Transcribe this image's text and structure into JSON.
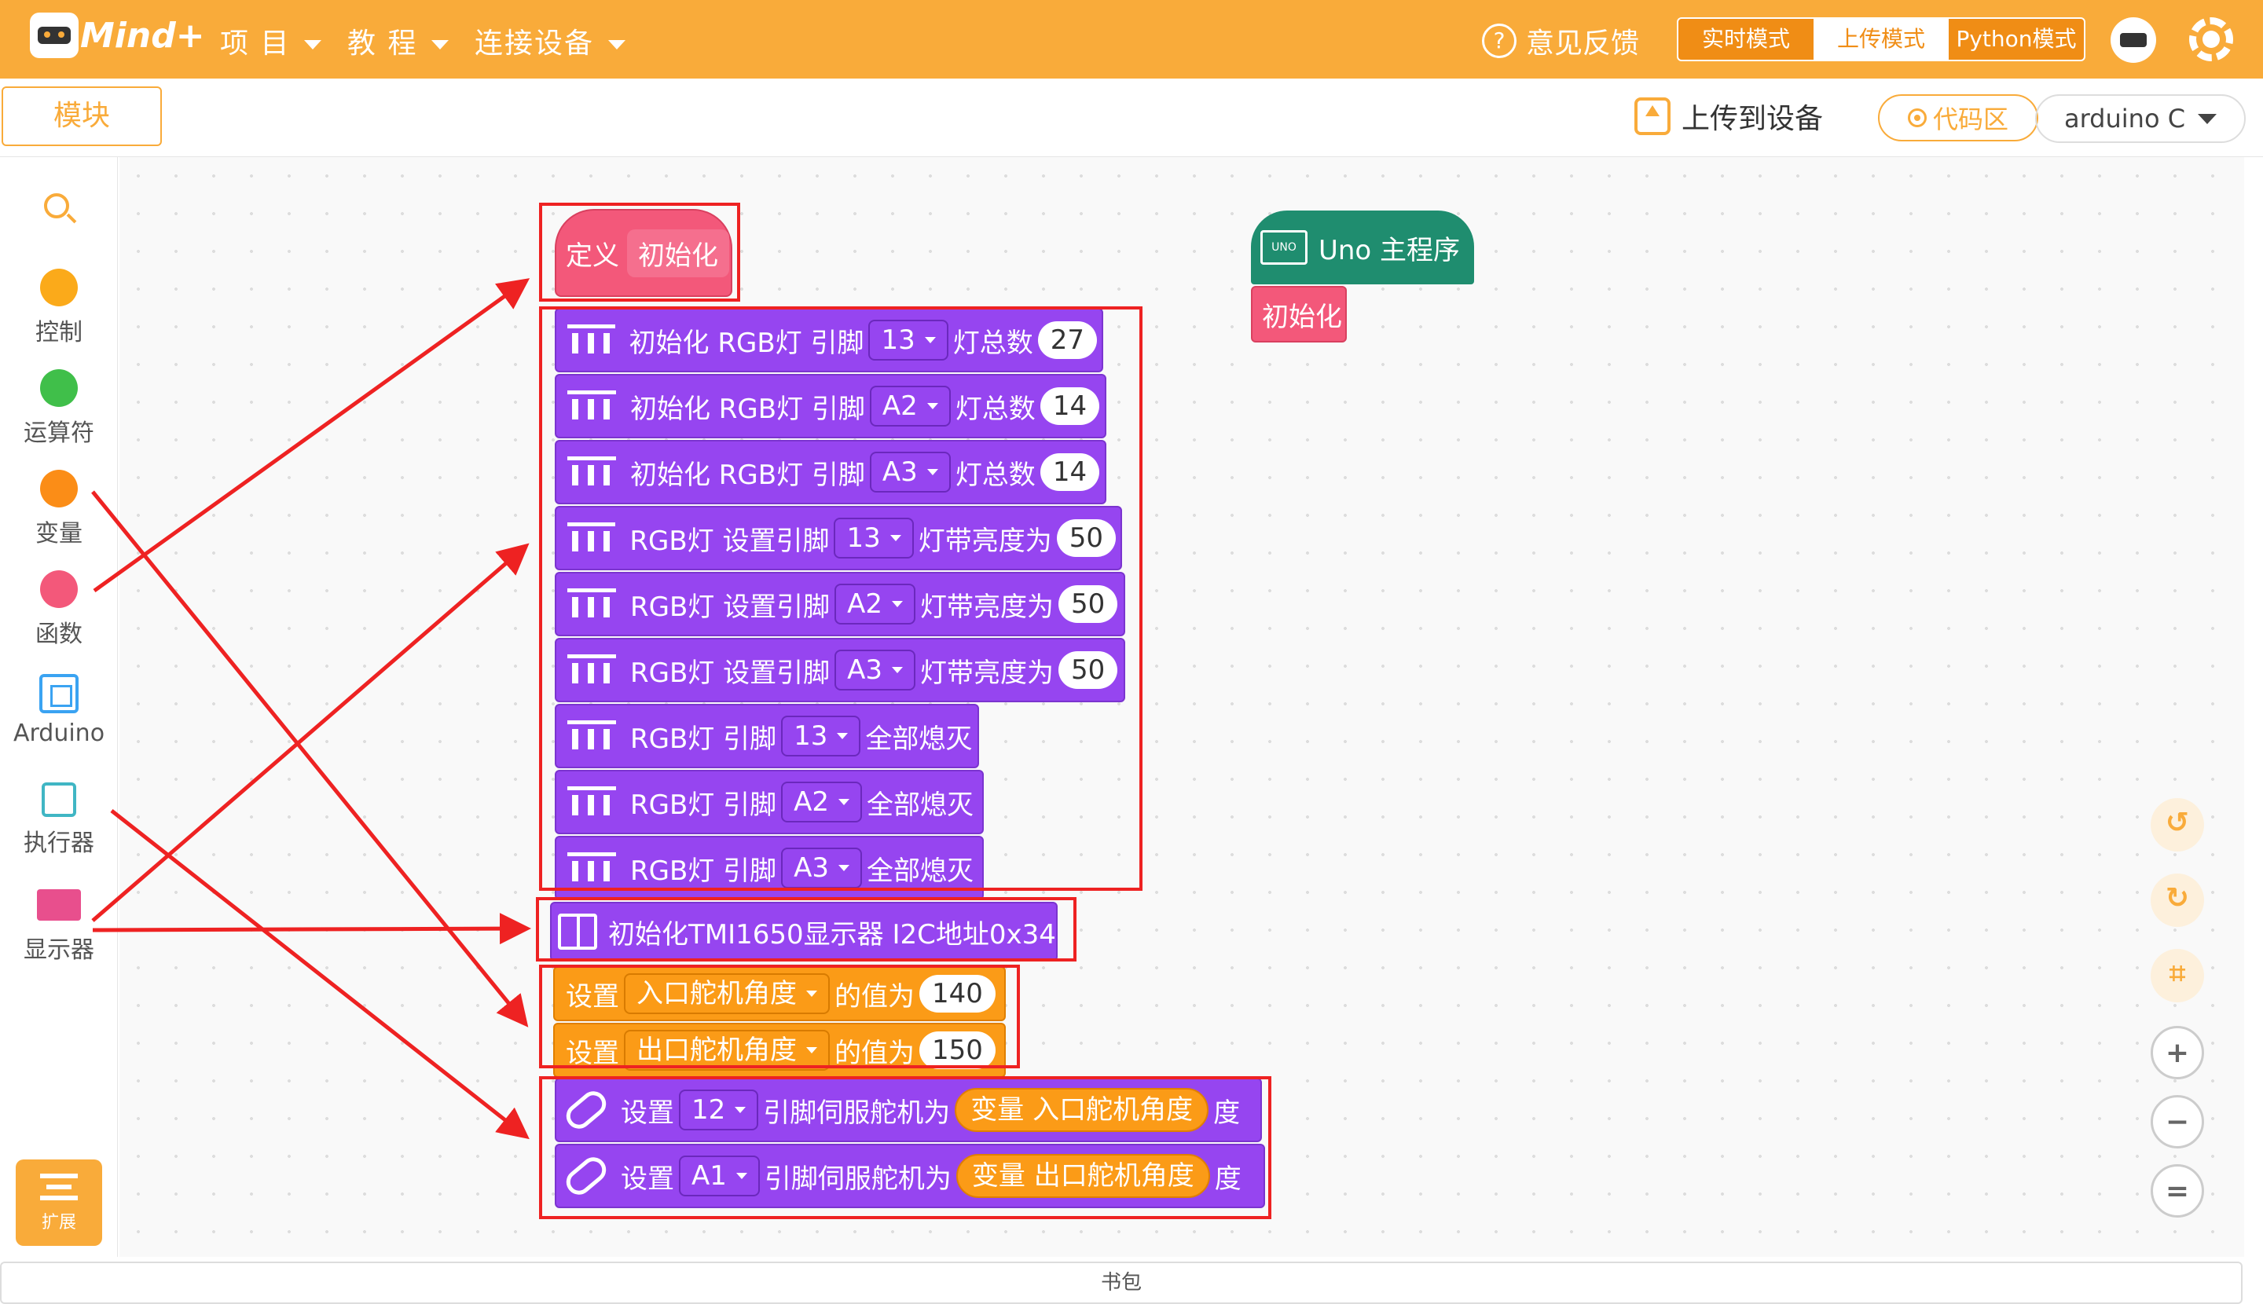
{
  "app": {
    "logo_text": "Mind+"
  },
  "menu": [
    {
      "label": "项 目"
    },
    {
      "label": "教 程"
    },
    {
      "label": "连接设备"
    }
  ],
  "feedback": {
    "label": "意见反馈",
    "icon": "question-icon"
  },
  "modes": [
    {
      "label": "实时模式"
    },
    {
      "label": "上传模式",
      "active": true
    },
    {
      "label": "Python模式"
    }
  ],
  "toolbar": {
    "modules_tab": "模块",
    "upload_label": "上传到设备",
    "code_label": "代码区",
    "language": "arduino C"
  },
  "sidebar": {
    "categories": [
      {
        "label": "控制",
        "color": "#fbaa1a"
      },
      {
        "label": "运算符",
        "color": "#40bf4a"
      },
      {
        "label": "变量",
        "color": "#fb8d17"
      },
      {
        "label": "函数",
        "color": "#f3587a"
      },
      {
        "label": "Arduino",
        "icon": "chip-icon"
      },
      {
        "label": "执行器",
        "icon": "actuator-icon"
      },
      {
        "label": "显示器",
        "icon": "display-icon"
      }
    ],
    "extension_label": "扩展"
  },
  "workspace": {
    "define_block": {
      "prefix": "定义",
      "name": "初始化"
    },
    "rgb_init": [
      {
        "prefix": "初始化 RGB灯 引脚",
        "pin": "13",
        "suffix": "灯总数",
        "count": "27"
      },
      {
        "prefix": "初始化 RGB灯 引脚",
        "pin": "A2",
        "suffix": "灯总数",
        "count": "14"
      },
      {
        "prefix": "初始化 RGB灯 引脚",
        "pin": "A3",
        "suffix": "灯总数",
        "count": "14"
      }
    ],
    "rgb_brightness": [
      {
        "prefix": "RGB灯 设置引脚",
        "pin": "13",
        "suffix": "灯带亮度为",
        "value": "50"
      },
      {
        "prefix": "RGB灯 设置引脚",
        "pin": "A2",
        "suffix": "灯带亮度为",
        "value": "50"
      },
      {
        "prefix": "RGB灯 设置引脚",
        "pin": "A3",
        "suffix": "灯带亮度为",
        "value": "50"
      }
    ],
    "rgb_off": [
      {
        "prefix": "RGB灯 引脚",
        "pin": "13",
        "suffix": "全部熄灭"
      },
      {
        "prefix": "RGB灯 引脚",
        "pin": "A2",
        "suffix": "全部熄灭"
      },
      {
        "prefix": "RGB灯 引脚",
        "pin": "A3",
        "suffix": "全部熄灭"
      }
    ],
    "tm1650": {
      "label": "初始化TMI1650显示器 I2C地址0x34"
    },
    "var_set": [
      {
        "prefix": "设置",
        "var": "入口舵机角度",
        "mid": "的值为",
        "value": "140"
      },
      {
        "prefix": "设置",
        "var": "出口舵机角度",
        "mid": "的值为",
        "value": "150"
      }
    ],
    "servo": [
      {
        "prefix": "设置",
        "pin": "12",
        "mid": "引脚伺服舵机为",
        "var": "变量 入口舵机角度",
        "suffix": "度"
      },
      {
        "prefix": "设置",
        "pin": "A1",
        "mid": "引脚伺服舵机为",
        "var": "变量 出口舵机角度",
        "suffix": "度"
      }
    ],
    "main_program": {
      "label": "Uno 主程序",
      "chip_text": "UNO",
      "call": "初始化"
    }
  },
  "controls": [
    {
      "icon": "undo-icon"
    },
    {
      "icon": "redo-icon"
    },
    {
      "icon": "crop-icon"
    },
    {
      "icon": "zoom-in-icon"
    },
    {
      "icon": "zoom-out-icon"
    },
    {
      "icon": "zoom-reset-icon",
      "glyph": "="
    }
  ],
  "bottom_bar": {
    "label": "书包"
  },
  "annotation_color": "#ee2222"
}
